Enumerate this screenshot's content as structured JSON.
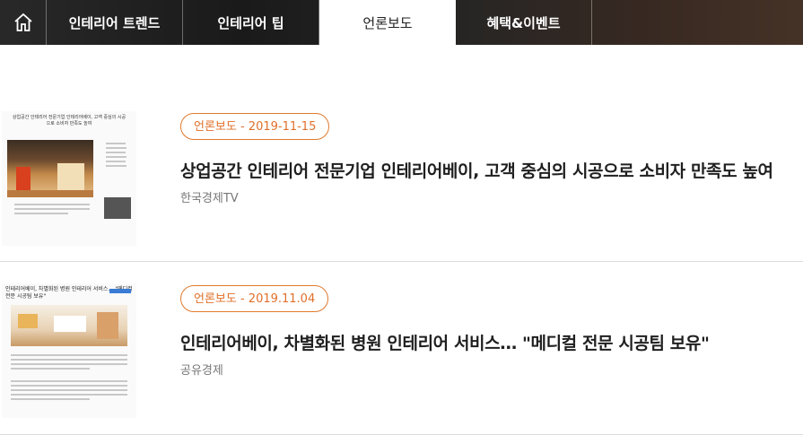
{
  "nav": {
    "home_icon": "home-icon",
    "tabs": [
      {
        "label": "인테리어 트렌드",
        "active": false
      },
      {
        "label": "인테리어 팁",
        "active": false
      },
      {
        "label": "언론보도",
        "active": true
      },
      {
        "label": "혜택&이벤트",
        "active": false
      }
    ]
  },
  "articles": [
    {
      "badge": "언론보도 - 2019-11-15",
      "title": "상업공간 인테리어 전문기업 인테리어베이, 고객 중심의 시공으로 소비자 만족도 높여",
      "source": "한국경제TV",
      "thumb_headline": "상업공간 인테리어 전문기업 인테리어베이, 고객 중심의 시공으로 소비자 만족도 높여"
    },
    {
      "badge": "언론보도 - 2019.11.04",
      "title": "인테리어베이, 차별화된 병원 인테리어 서비스… \"메디컬 전문 시공팀 보유\"",
      "source": "공유경제",
      "thumb_headline": "인테리어베이, 차별화된 병원 인테리어 서비스… \"메디컬 전문 시공팀 보유\""
    }
  ],
  "colors": {
    "accent": "#e0702a",
    "nav_bg": "#1b1b1b"
  }
}
